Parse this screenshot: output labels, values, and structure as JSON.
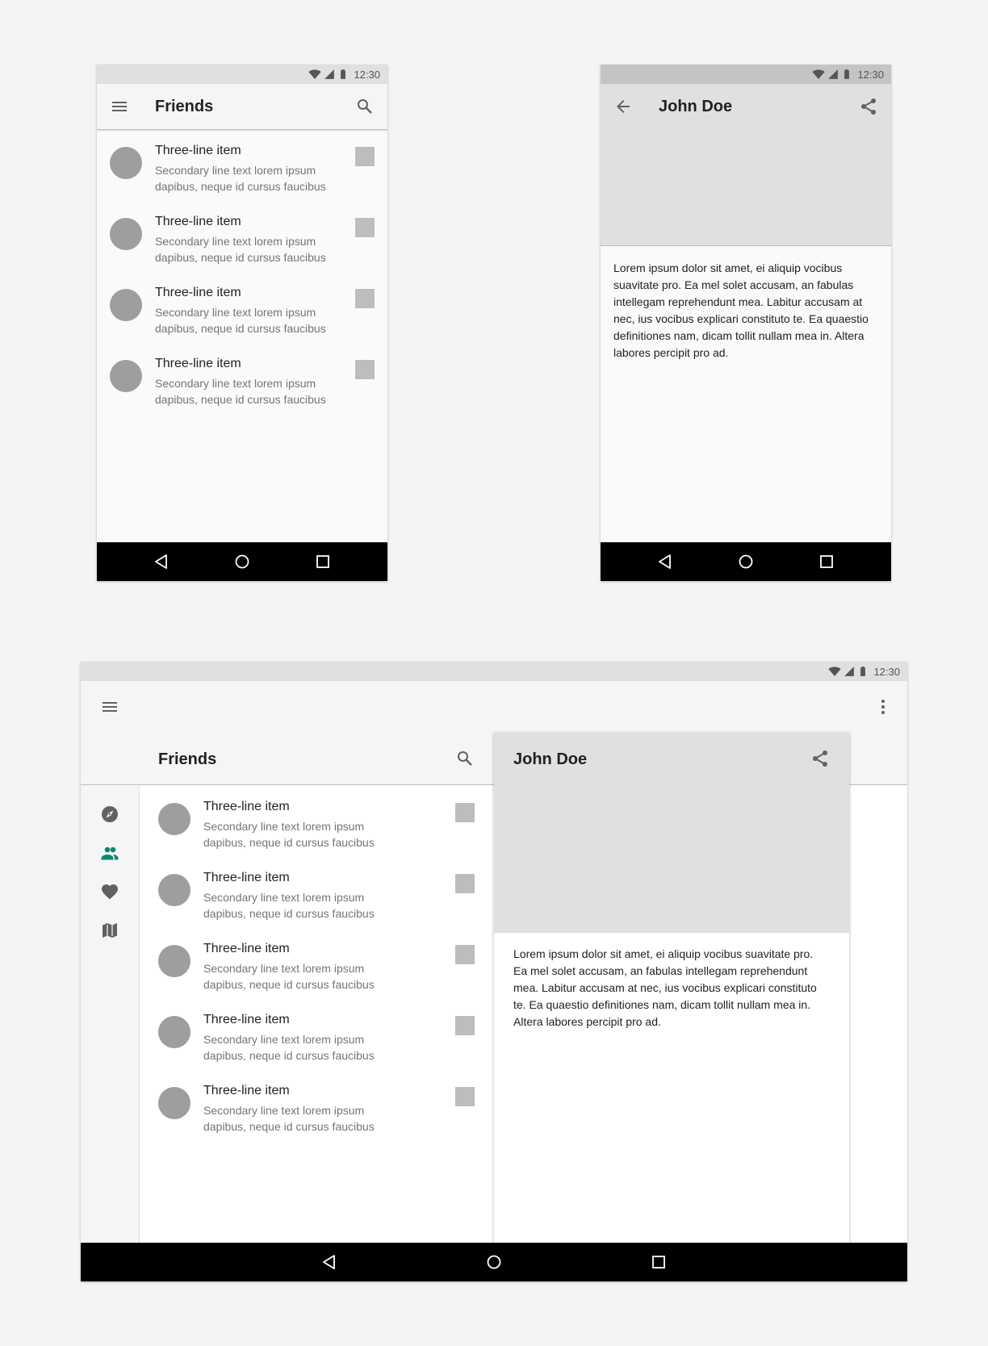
{
  "status": {
    "time": "12:30"
  },
  "friends": {
    "title": "Friends",
    "items": [
      {
        "primary": "Three-line item",
        "secondary": "Secondary line text lorem ipsum dapibus, neque id cursus faucibus"
      },
      {
        "primary": "Three-line item",
        "secondary": "Secondary line text lorem ipsum dapibus, neque id cursus faucibus"
      },
      {
        "primary": "Three-line item",
        "secondary": "Secondary line text lorem ipsum dapibus, neque id cursus faucibus"
      },
      {
        "primary": "Three-line item",
        "secondary": "Secondary line text lorem ipsum dapibus, neque id cursus faucibus"
      },
      {
        "primary": "Three-line item",
        "secondary": "Secondary line text lorem ipsum dapibus, neque id cursus faucibus"
      }
    ]
  },
  "detail": {
    "title": "John Doe",
    "body": "Lorem ipsum dolor sit amet, ei aliquip vocibus suavitate pro. Ea mel solet accusam, an fabulas intellegam reprehendunt mea. Labitur accusam at nec, ius vocibus explicari constituto te. Ea quaestio definitiones nam, dicam tollit nullam mea in. Altera labores percipit pro ad."
  },
  "icons": {
    "menu": "menu-icon",
    "search": "search-icon",
    "back": "arrow-back-icon",
    "share": "share-icon",
    "more": "more-vert-icon",
    "rail": [
      "explore-icon",
      "people-icon",
      "favorite-icon",
      "map-icon"
    ]
  },
  "colors": {
    "accent": "#00897b",
    "icon": "#616161",
    "appbar": "#f5f5f5",
    "hero": "#e0e0e0",
    "navbar": "#000000"
  }
}
